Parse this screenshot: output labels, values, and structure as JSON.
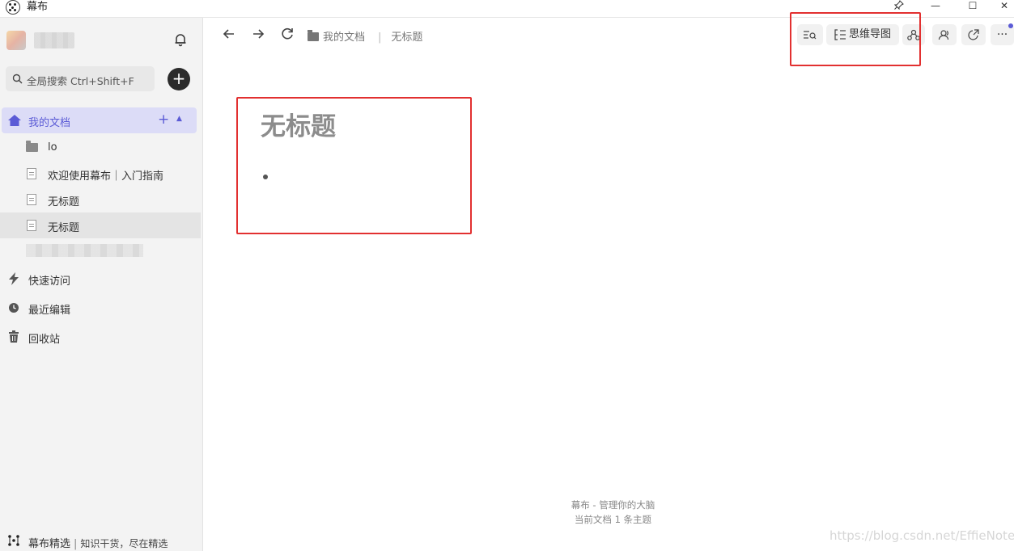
{
  "window": {
    "app_title": "幕布",
    "pin_glyph": "📌",
    "minimize_glyph": "—",
    "maximize_glyph": "☐",
    "close_glyph": "✕"
  },
  "sidebar": {
    "search_label": "全局搜索 Ctrl+Shift+F",
    "add_glyph": "+",
    "root": {
      "label": "我的文档",
      "plus_glyph": "+",
      "caret_glyph": "▲"
    },
    "items": [
      {
        "label": "lo",
        "type": "folder"
      },
      {
        "label": "欢迎使用幕布｜入门指南",
        "type": "doc"
      },
      {
        "label": "无标题",
        "type": "doc"
      },
      {
        "label": "无标题",
        "type": "doc",
        "selected": true
      }
    ],
    "menu": [
      {
        "label": "快速访问",
        "icon": "lightning-icon"
      },
      {
        "label": "最近编辑",
        "icon": "clock-icon"
      },
      {
        "label": "回收站",
        "icon": "trash-icon"
      }
    ],
    "footer": {
      "title": "幕布精选",
      "separator": "|",
      "subtitle": "知识干货，尽在精选"
    }
  },
  "toolbar": {
    "breadcrumb_folder": "我的文档",
    "breadcrumb_separator": "|",
    "breadcrumb_current": "无标题",
    "mindmap_label": "思维导图",
    "more_glyph": "···"
  },
  "editor": {
    "title": "无标题"
  },
  "footer": {
    "line1": "幕布 - 管理你的大脑",
    "line2": "当前文档 1 条主题"
  },
  "watermark": "https://blog.csdn.net/EffieNotes",
  "colors": {
    "accent": "#5b5bd6",
    "annotation_red": "#e23030",
    "sidebar_bg": "#f3f3f3"
  }
}
